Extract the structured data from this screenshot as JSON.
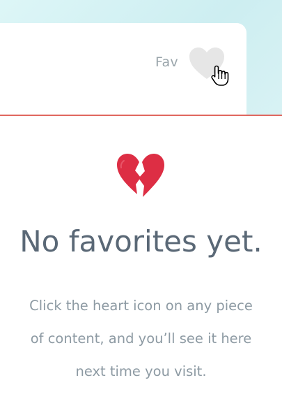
{
  "card": {
    "fav_label": "Fav"
  },
  "empty_state": {
    "title": "No favorites yet.",
    "message": "Click the heart icon on any piece of content, and you’ll see it here next time you visit."
  },
  "colors": {
    "top_background": "#d4f0f2",
    "divider": "#e0675f",
    "heart_outline": "#e6e6e6",
    "broken_heart": "#dd2e44",
    "title_text": "#5a6876",
    "body_text": "#8d9aa3"
  },
  "icons": {
    "favorite": "heart-icon",
    "cursor": "hand-pointer-cursor-icon",
    "empty": "broken-heart-icon"
  }
}
